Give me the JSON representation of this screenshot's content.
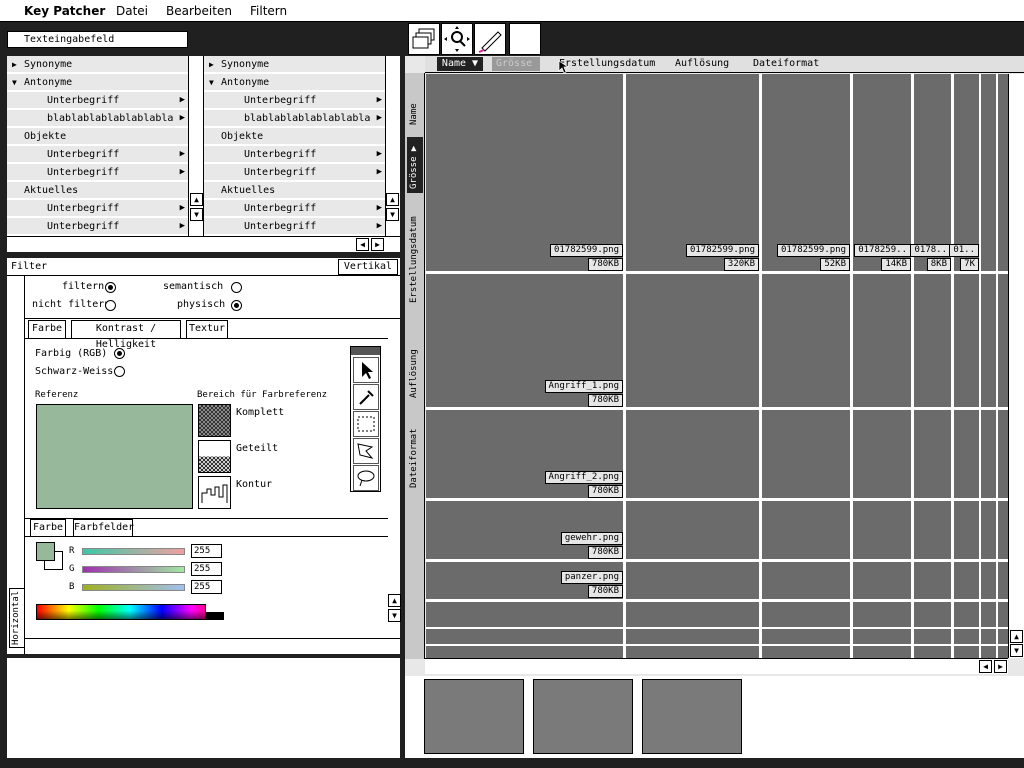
{
  "menu": {
    "app": "Key Patcher",
    "items": [
      "Datei",
      "Bearbeiten",
      "Filtern"
    ]
  },
  "text_input": {
    "value": "Texteingabefeld"
  },
  "tree_left": [
    {
      "label": "Synonyme",
      "type": "collapsed",
      "indent": 0
    },
    {
      "label": "Antonyme",
      "type": "expanded",
      "indent": 0
    },
    {
      "label": "Unterbegriff",
      "type": "sub",
      "indent": 1
    },
    {
      "label": "blablablablablablabla",
      "type": "sub",
      "indent": 1
    },
    {
      "label": "Objekte",
      "type": "plain",
      "indent": 0
    },
    {
      "label": "Unterbegriff",
      "type": "sub",
      "indent": 1
    },
    {
      "label": "Unterbegriff",
      "type": "sub",
      "indent": 1
    },
    {
      "label": "Aktuelles",
      "type": "plain",
      "indent": 0
    },
    {
      "label": "Unterbegriff",
      "type": "sub",
      "indent": 1
    },
    {
      "label": "Unterbegriff",
      "type": "sub",
      "indent": 1
    }
  ],
  "tree_right": [
    {
      "label": "Synonyme",
      "type": "collapsed",
      "indent": 0
    },
    {
      "label": "Antonyme",
      "type": "expanded",
      "indent": 0
    },
    {
      "label": "Unterbegriff",
      "type": "sub",
      "indent": 1
    },
    {
      "label": "blablablablablablabla",
      "type": "sub",
      "indent": 1
    },
    {
      "label": "Objekte",
      "type": "plain",
      "indent": 0
    },
    {
      "label": "Unterbegriff",
      "type": "sub",
      "indent": 1
    },
    {
      "label": "Unterbegriff",
      "type": "sub",
      "indent": 1
    },
    {
      "label": "Aktuelles",
      "type": "plain",
      "indent": 0
    },
    {
      "label": "Unterbegriff",
      "type": "sub",
      "indent": 1
    },
    {
      "label": "Unterbegriff",
      "type": "sub",
      "indent": 1
    }
  ],
  "filter": {
    "title": "Filter",
    "orientation_button": "Vertikal",
    "side_tab": "Horizontal",
    "options": [
      {
        "label": "filtern",
        "checked": true
      },
      {
        "label": "semantisch",
        "checked": false
      },
      {
        "label": "nicht filtern",
        "checked": false
      },
      {
        "label": "physisch",
        "checked": true
      }
    ],
    "tabs": [
      "Farbe",
      "Kontrast / Helligkeit",
      "Textur"
    ],
    "mode_options": [
      {
        "label": "Farbig (RGB)",
        "checked": true
      },
      {
        "label": "Schwarz-Weiss",
        "checked": false
      }
    ],
    "reference_label": "Referenz",
    "reference_color": "#98b89c",
    "region_label": "Bereich für Farbreferenz",
    "regions": [
      "Komplett",
      "Geteilt",
      "Kontur"
    ],
    "color_tabs": [
      "Farbe",
      "Farbfelder"
    ],
    "channels": [
      {
        "name": "R",
        "value": "255"
      },
      {
        "name": "G",
        "value": "255"
      },
      {
        "name": "B",
        "value": "255"
      }
    ]
  },
  "toolbar": {
    "icons": [
      "windows-icon",
      "zoom-icon",
      "pen-icon",
      "blank"
    ]
  },
  "columns": {
    "headers": [
      "Name",
      "Grösse",
      "Erstellungsdatum",
      "Auflösung",
      "Dateiformat"
    ],
    "active": "Name",
    "side_headers": [
      "Name",
      "Grösse",
      "Erstellungsdatum",
      "Auflösung",
      "Dateiformat"
    ]
  },
  "grid_labels": [
    {
      "name": "01782599.png",
      "size": "780KB"
    },
    {
      "name": "01782599.png",
      "size": "320KB"
    },
    {
      "name": "01782599.png",
      "size": "52KB"
    },
    {
      "name": "0178259..",
      "size": "14KB"
    },
    {
      "name": "0178..",
      "size": "8KB"
    },
    {
      "name": "01..",
      "size": "7K"
    },
    {
      "name": "Angriff_1.png",
      "size": "780KB"
    },
    {
      "name": "Angriff_2.png",
      "size": "780KB"
    },
    {
      "name": "gewehr.png",
      "size": "780KB"
    },
    {
      "name": "panzer.png",
      "size": "780KB"
    }
  ],
  "colors": {
    "grid": "#6b6b6b",
    "panel": "#e8e8e8",
    "frame": "#202020"
  }
}
